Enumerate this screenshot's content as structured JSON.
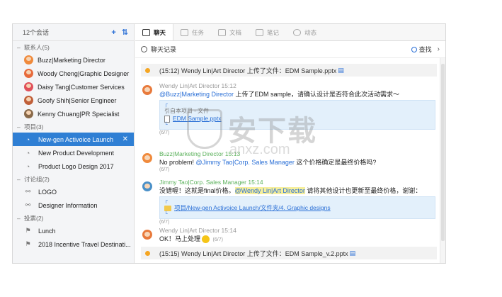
{
  "sidebar": {
    "count_label": "12个会话",
    "add_icon": "plus-icon",
    "sort_icon": "sort-icon",
    "groups": [
      {
        "label": "联系人(5)"
      },
      {
        "label": "项目(3)"
      },
      {
        "label": "讨论组(2)"
      },
      {
        "label": "投票(2)"
      }
    ],
    "contacts": [
      {
        "label": "Buzz|Marketing Director",
        "color": "#f08a3c"
      },
      {
        "label": "Woody Cheng|Graphic Designer",
        "color": "#e76b3c"
      },
      {
        "label": "Daisy Tang|Customer Services",
        "color": "#e0505a"
      },
      {
        "label": "Goofy Shih|Senior Engineer",
        "color": "#c0603a"
      },
      {
        "label": "Kenny Chuang|PR Specialist",
        "color": "#8a6a4a"
      }
    ],
    "projects": [
      {
        "label": "New-gen Activoice Launch"
      },
      {
        "label": "New Product Development"
      },
      {
        "label": "Product Logo Design 2017"
      }
    ],
    "discussions": [
      {
        "label": "LOGO"
      },
      {
        "label": "Designer Information"
      }
    ],
    "polls": [
      {
        "label": "Lunch"
      },
      {
        "label": "2018 Incentive Travel Destinati..."
      }
    ]
  },
  "tabs": [
    {
      "label": "聊天"
    },
    {
      "label": "任务"
    },
    {
      "label": "文档"
    },
    {
      "label": "笔记"
    },
    {
      "label": "动态"
    }
  ],
  "subbar": {
    "title": "聊天记录",
    "search_label": "查找"
  },
  "messages": {
    "sys1": {
      "text": "(15:12) Wendy Lin|Art Director 上传了文件：EDM Sample.pptx"
    },
    "m1": {
      "meta": "Wendy Lin|Art Director  15:12",
      "mention": "@Buzz|Marketing Director",
      "text": " 上传了EDM sample，请确认设计是否符合此次活动需求～",
      "quote_caption": "引自本项目 - 文件",
      "quote_link": "EDM Sample.pptx",
      "read": "(6/7)"
    },
    "m2": {
      "meta": "Buzz|Marketing Director  15:13",
      "text": "No problem! ",
      "mention": "@Jimmy Tao|Corp. Sales Manager",
      "text2": " 这个价格确定是最终价格吗?",
      "read": "(6/7)"
    },
    "m3": {
      "meta": "Jimmy Tao|Corp. Sales Manager  15:14",
      "text": "没错喔！这就是final价格。",
      "mention": "@Wendy Lin|Art Director",
      "text2": " 请将其他设计也更新至最终价格，谢谢：",
      "quote_link": "项目/New-gen Activoice Launch/文件夹/4. Graphic designs",
      "read": "(6/7)"
    },
    "m4": {
      "meta": "Wendy Lin|Art Director  15:14",
      "text": "OK！马上处理",
      "read": "(6/7)"
    },
    "sys2": {
      "text": "(15:15) Wendy Lin|Art Director 上传了文件：EDM Sample_v.2.pptx"
    }
  },
  "watermark": {
    "text": "安下载",
    "sub": "anxz.com"
  }
}
